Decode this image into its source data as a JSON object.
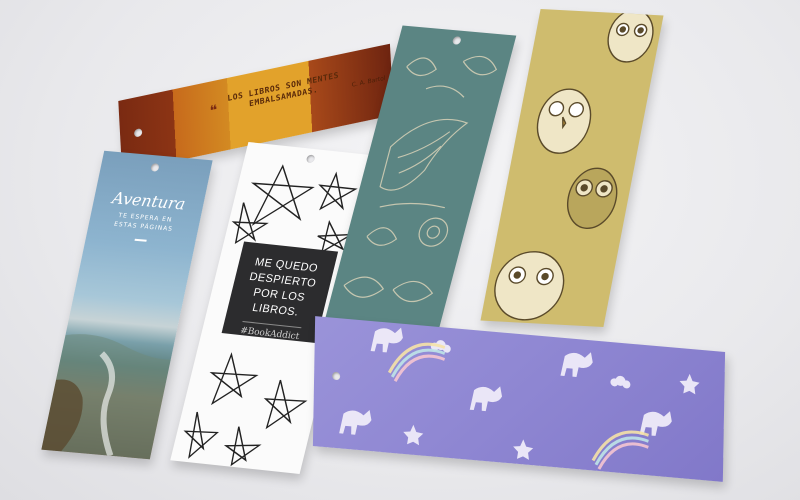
{
  "scene": {
    "background_color": "#e9e9ec"
  },
  "bookmarks": {
    "quote": {
      "text": "LOS LIBROS SON MENTES EMBALSAMADAS.",
      "author": "C. A. Bartol",
      "colors": [
        "#7a2a12",
        "#c76a1c",
        "#e2a22b",
        "#a8491a"
      ]
    },
    "adventure": {
      "title": "Aventura",
      "subtitle": "TE ESPERA EN ESTAS PÁGINAS"
    },
    "bookaddict": {
      "quote": "ME QUEDO DESPIERTO POR LOS LIBROS.",
      "hashtag": "#BookAddict"
    },
    "bird": {
      "pattern": "bird-floral-pattern",
      "color": "#5b8583"
    },
    "owls": {
      "pattern": "owl-pattern",
      "color": "#cfbc6e"
    },
    "unicorn": {
      "pattern": "unicorn-rainbow-pattern",
      "color": "#8e86d2"
    }
  }
}
